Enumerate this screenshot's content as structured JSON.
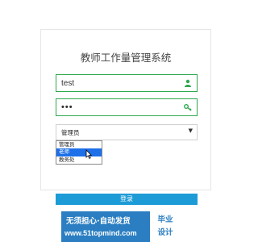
{
  "title": "教师工作量管理系统",
  "username": {
    "value": "test",
    "icon": "user-icon"
  },
  "password": {
    "value": "•••",
    "icon": "key-icon"
  },
  "role_select": {
    "selected": "管理员",
    "caret": "▼",
    "options": [
      "管理员",
      "老师",
      "教务处"
    ],
    "highlighted_index": 1
  },
  "login_button": "登录",
  "banner": {
    "line1": "无须担心·自动发货",
    "line2": "www.51topmind.com",
    "badge_line1": "毕业",
    "badge_line2": "设计"
  },
  "colors": {
    "field_border": "#2fa84f",
    "button": "#1d9bd7",
    "option_highlight": "#1e70e8",
    "banner": "#2a7ec1"
  }
}
